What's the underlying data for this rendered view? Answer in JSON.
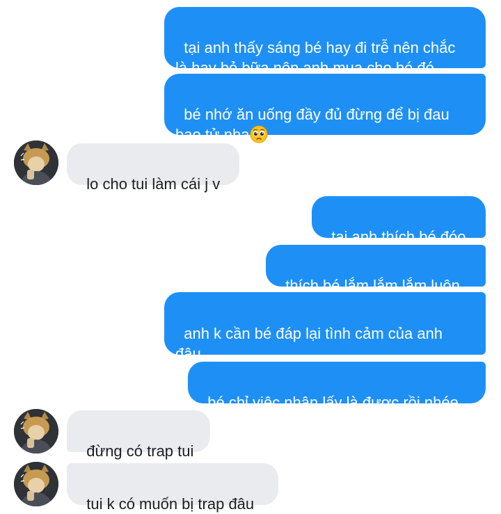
{
  "messages": [
    {
      "from": "me",
      "text": "tại anh thấy sáng bé hay đi trễ nên chắc\nlà hay bỏ bữa nên anh mua cho bé đó"
    },
    {
      "from": "me",
      "text": "bé nhớ ăn uống đầy đủ đừng để bị đau\nbao tử nha",
      "emoji": "pleading-face-emoji"
    },
    {
      "from": "them",
      "text": "lo cho tui làm cái j v"
    },
    {
      "from": "me",
      "text": "tại anh thích bé đóo"
    },
    {
      "from": "me",
      "text": "thích bé lắm lắm lắm luôn"
    },
    {
      "from": "me",
      "text": "anh k cần bé đáp lại tình cảm của anh\nđâu"
    },
    {
      "from": "me",
      "text": "bé chỉ việc nhận lấy là được rồi nhée"
    },
    {
      "from": "them",
      "text": "đừng có trap tui"
    },
    {
      "from": "them",
      "text": "tui k có muốn bị trap đâu"
    }
  ],
  "colors": {
    "sent_bubble": "#1e90f5",
    "received_bubble": "#e9ebee",
    "sent_text": "#ffffff",
    "received_text": "#1c1e21"
  },
  "icons": {
    "avatar": "contact-avatar",
    "emoji": "pleading-face-emoji"
  }
}
